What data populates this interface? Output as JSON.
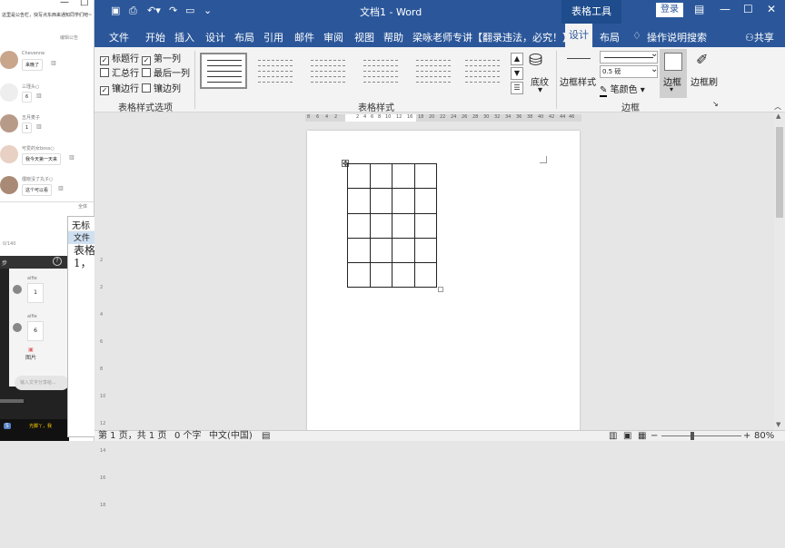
{
  "chat": {
    "notice": "这里是公告栏，快写点东西来通知同学们吧~",
    "notice_tag": "编辑公告",
    "messages": [
      {
        "name": "Chevenne",
        "text": "来晚了"
      },
      {
        "name": "三瑾头○",
        "text": "6"
      },
      {
        "name": "五月麦子",
        "text": "1"
      },
      {
        "name": "可爱的女boss○",
        "text": "我今天第一天来"
      },
      {
        "name": "僵晓没了丸子○",
        "text": "这个可以看"
      }
    ],
    "full_label": "全体",
    "char_count": "0/140",
    "header": "步",
    "video_msgs": [
      {
        "name": "alfie",
        "text": "1"
      },
      {
        "name": "alfie",
        "text": "6"
      }
    ],
    "picture_label": "图片",
    "input_placeholder": "输入文字分享给...",
    "live_badge": "5",
    "live_text": "光脚丫，我"
  },
  "notepad": {
    "title": "无标",
    "menu": "文件",
    "content_line1": "表格",
    "content_line2": "1，"
  },
  "word": {
    "title": "文档1 - Word",
    "context_tab": "表格工具",
    "login": "登录",
    "tabs": [
      "文件",
      "开始",
      "插入",
      "设计",
      "布局",
      "引用",
      "邮件",
      "审阅",
      "视图",
      "帮助",
      "梁咏老师专讲【翻录违法，必究！】",
      "设计",
      "布局"
    ],
    "tell_me": "操作说明搜索",
    "share": "共享",
    "style_options": [
      {
        "label": "标题行",
        "checked": true
      },
      {
        "label": "第一列",
        "checked": true
      },
      {
        "label": "汇总行",
        "checked": false
      },
      {
        "label": "最后一列",
        "checked": false
      },
      {
        "label": "镶边行",
        "checked": true
      },
      {
        "label": "镶边列",
        "checked": false
      }
    ],
    "group_style_options": "表格样式选项",
    "group_table_styles": "表格样式",
    "shading": "底纹",
    "border_styles": "边框样式",
    "pen_weight": "0.5 磅",
    "pen_color": "笔颜色",
    "borders": "边框",
    "border_painter": "边框刷",
    "group_borders": "边框",
    "ruler_numbers": [
      "8",
      "6",
      "4",
      "2",
      "2",
      "4",
      "6",
      "8",
      "10",
      "12",
      "16",
      "18",
      "20",
      "22",
      "24",
      "26",
      "28",
      "30",
      "32",
      "34",
      "36",
      "38",
      "40",
      "42",
      "44",
      "46",
      "48"
    ],
    "table": {
      "rows": 5,
      "cols": 4
    },
    "status": {
      "page": "第 1 页，共 1 页",
      "words": "0 个字",
      "language": "中文(中国)",
      "zoom": "80%"
    }
  }
}
